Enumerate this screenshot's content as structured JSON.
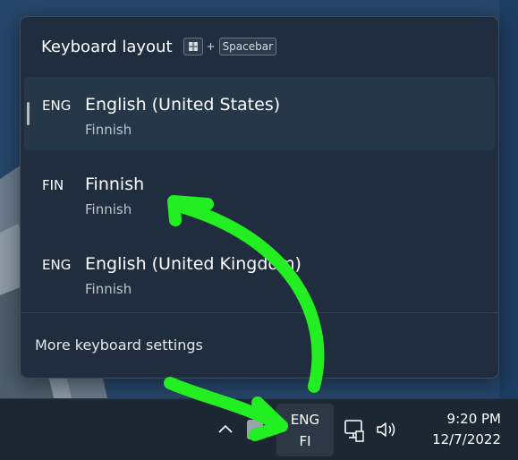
{
  "flyout": {
    "title": "Keyboard layout",
    "shortcut_plus": "+",
    "shortcut_key": "Spacebar",
    "shortcut_icon": "windows-key-icon",
    "layouts": [
      {
        "code": "ENG",
        "name": "English (United States)",
        "keyboard": "Finnish",
        "selected": true
      },
      {
        "code": "FIN",
        "name": "Finnish",
        "keyboard": "Finnish",
        "selected": false
      },
      {
        "code": "ENG",
        "name": "English (United Kingdom)",
        "keyboard": "Finnish",
        "selected": false
      }
    ],
    "more_settings_label": "More keyboard settings"
  },
  "taskbar": {
    "chevron": "^",
    "language_indicator": {
      "line1": "ENG",
      "line2": "FI"
    },
    "icons": [
      "chevron-up-icon",
      "network-icon",
      "volume-icon"
    ],
    "clock": {
      "time": "9:20 PM",
      "date": "12/7/2022"
    }
  },
  "annotation": {
    "color": "#22ee22"
  }
}
